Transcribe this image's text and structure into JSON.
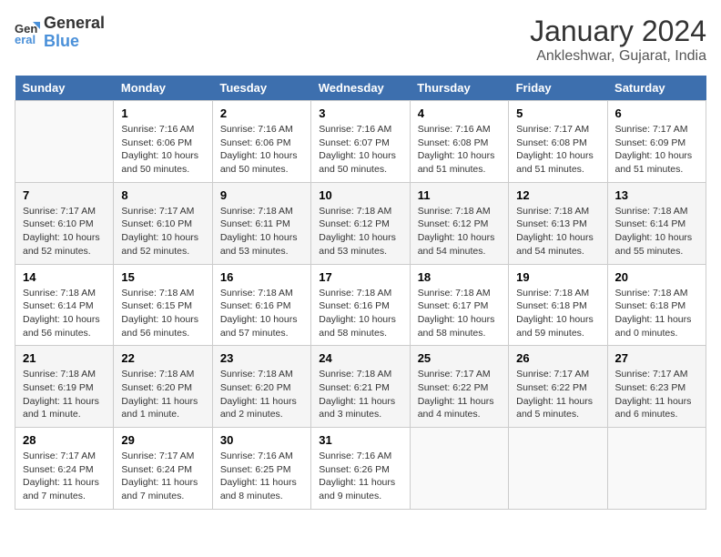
{
  "logo": {
    "line1": "General",
    "line2": "Blue"
  },
  "title": "January 2024",
  "subtitle": "Ankleshwar, Gujarat, India",
  "days_of_week": [
    "Sunday",
    "Monday",
    "Tuesday",
    "Wednesday",
    "Thursday",
    "Friday",
    "Saturday"
  ],
  "weeks": [
    [
      {
        "day": "",
        "info": ""
      },
      {
        "day": "1",
        "info": "Sunrise: 7:16 AM\nSunset: 6:06 PM\nDaylight: 10 hours\nand 50 minutes."
      },
      {
        "day": "2",
        "info": "Sunrise: 7:16 AM\nSunset: 6:06 PM\nDaylight: 10 hours\nand 50 minutes."
      },
      {
        "day": "3",
        "info": "Sunrise: 7:16 AM\nSunset: 6:07 PM\nDaylight: 10 hours\nand 50 minutes."
      },
      {
        "day": "4",
        "info": "Sunrise: 7:16 AM\nSunset: 6:08 PM\nDaylight: 10 hours\nand 51 minutes."
      },
      {
        "day": "5",
        "info": "Sunrise: 7:17 AM\nSunset: 6:08 PM\nDaylight: 10 hours\nand 51 minutes."
      },
      {
        "day": "6",
        "info": "Sunrise: 7:17 AM\nSunset: 6:09 PM\nDaylight: 10 hours\nand 51 minutes."
      }
    ],
    [
      {
        "day": "7",
        "info": "Sunrise: 7:17 AM\nSunset: 6:10 PM\nDaylight: 10 hours\nand 52 minutes."
      },
      {
        "day": "8",
        "info": "Sunrise: 7:17 AM\nSunset: 6:10 PM\nDaylight: 10 hours\nand 52 minutes."
      },
      {
        "day": "9",
        "info": "Sunrise: 7:18 AM\nSunset: 6:11 PM\nDaylight: 10 hours\nand 53 minutes."
      },
      {
        "day": "10",
        "info": "Sunrise: 7:18 AM\nSunset: 6:12 PM\nDaylight: 10 hours\nand 53 minutes."
      },
      {
        "day": "11",
        "info": "Sunrise: 7:18 AM\nSunset: 6:12 PM\nDaylight: 10 hours\nand 54 minutes."
      },
      {
        "day": "12",
        "info": "Sunrise: 7:18 AM\nSunset: 6:13 PM\nDaylight: 10 hours\nand 54 minutes."
      },
      {
        "day": "13",
        "info": "Sunrise: 7:18 AM\nSunset: 6:14 PM\nDaylight: 10 hours\nand 55 minutes."
      }
    ],
    [
      {
        "day": "14",
        "info": "Sunrise: 7:18 AM\nSunset: 6:14 PM\nDaylight: 10 hours\nand 56 minutes."
      },
      {
        "day": "15",
        "info": "Sunrise: 7:18 AM\nSunset: 6:15 PM\nDaylight: 10 hours\nand 56 minutes."
      },
      {
        "day": "16",
        "info": "Sunrise: 7:18 AM\nSunset: 6:16 PM\nDaylight: 10 hours\nand 57 minutes."
      },
      {
        "day": "17",
        "info": "Sunrise: 7:18 AM\nSunset: 6:16 PM\nDaylight: 10 hours\nand 58 minutes."
      },
      {
        "day": "18",
        "info": "Sunrise: 7:18 AM\nSunset: 6:17 PM\nDaylight: 10 hours\nand 58 minutes."
      },
      {
        "day": "19",
        "info": "Sunrise: 7:18 AM\nSunset: 6:18 PM\nDaylight: 10 hours\nand 59 minutes."
      },
      {
        "day": "20",
        "info": "Sunrise: 7:18 AM\nSunset: 6:18 PM\nDaylight: 11 hours\nand 0 minutes."
      }
    ],
    [
      {
        "day": "21",
        "info": "Sunrise: 7:18 AM\nSunset: 6:19 PM\nDaylight: 11 hours\nand 1 minute."
      },
      {
        "day": "22",
        "info": "Sunrise: 7:18 AM\nSunset: 6:20 PM\nDaylight: 11 hours\nand 1 minute."
      },
      {
        "day": "23",
        "info": "Sunrise: 7:18 AM\nSunset: 6:20 PM\nDaylight: 11 hours\nand 2 minutes."
      },
      {
        "day": "24",
        "info": "Sunrise: 7:18 AM\nSunset: 6:21 PM\nDaylight: 11 hours\nand 3 minutes."
      },
      {
        "day": "25",
        "info": "Sunrise: 7:17 AM\nSunset: 6:22 PM\nDaylight: 11 hours\nand 4 minutes."
      },
      {
        "day": "26",
        "info": "Sunrise: 7:17 AM\nSunset: 6:22 PM\nDaylight: 11 hours\nand 5 minutes."
      },
      {
        "day": "27",
        "info": "Sunrise: 7:17 AM\nSunset: 6:23 PM\nDaylight: 11 hours\nand 6 minutes."
      }
    ],
    [
      {
        "day": "28",
        "info": "Sunrise: 7:17 AM\nSunset: 6:24 PM\nDaylight: 11 hours\nand 7 minutes."
      },
      {
        "day": "29",
        "info": "Sunrise: 7:17 AM\nSunset: 6:24 PM\nDaylight: 11 hours\nand 7 minutes."
      },
      {
        "day": "30",
        "info": "Sunrise: 7:16 AM\nSunset: 6:25 PM\nDaylight: 11 hours\nand 8 minutes."
      },
      {
        "day": "31",
        "info": "Sunrise: 7:16 AM\nSunset: 6:26 PM\nDaylight: 11 hours\nand 9 minutes."
      },
      {
        "day": "",
        "info": ""
      },
      {
        "day": "",
        "info": ""
      },
      {
        "day": "",
        "info": ""
      }
    ]
  ]
}
